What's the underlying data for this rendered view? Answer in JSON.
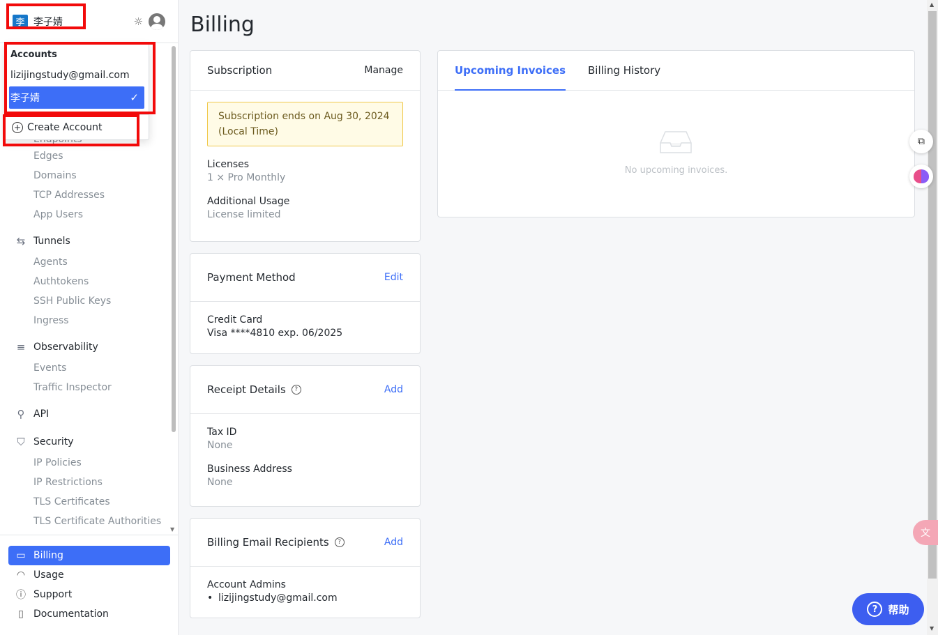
{
  "header": {
    "account_initial": "李",
    "account_name": "李子婧"
  },
  "dropdown": {
    "label": "Accounts",
    "items": [
      {
        "label": "lizijingstudy@gmail.com"
      },
      {
        "label": "李子婧"
      }
    ],
    "create_label": "Create Account"
  },
  "sidebar": {
    "partial_item": "Endpoints",
    "sub_items_1": [
      "Edges",
      "Domains",
      "TCP Addresses",
      "App Users"
    ],
    "tunnels": "Tunnels",
    "sub_items_tunnels": [
      "Agents",
      "Authtokens",
      "SSH Public Keys",
      "Ingress"
    ],
    "observability": "Observability",
    "sub_items_obs": [
      "Events",
      "Traffic Inspector"
    ],
    "api": "API",
    "security": "Security",
    "sub_items_security": [
      "IP Policies",
      "IP Restrictions",
      "TLS Certificates",
      "TLS Certificate Authorities"
    ],
    "bottom": [
      "Billing",
      "Usage",
      "Support",
      "Documentation"
    ]
  },
  "page": {
    "title": "Billing"
  },
  "subscription": {
    "title": "Subscription",
    "action": "Manage",
    "notice": "Subscription ends on Aug 30, 2024 (Local Time)",
    "licenses_label": "Licenses",
    "licenses_value": "1 × Pro Monthly",
    "usage_label": "Additional Usage",
    "usage_value": "License limited"
  },
  "payment": {
    "title": "Payment Method",
    "action": "Edit",
    "label": "Credit Card",
    "value": "Visa ****4810 exp. 06/2025"
  },
  "receipt": {
    "title": "Receipt Details",
    "action": "Add",
    "tax_label": "Tax ID",
    "tax_value": "None",
    "address_label": "Business Address",
    "address_value": "None"
  },
  "recipients": {
    "title": "Billing Email Recipients",
    "action": "Add",
    "label": "Account Admins",
    "value": "lizijingstudy@gmail.com"
  },
  "invoices": {
    "tabs": [
      "Upcoming Invoices",
      "Billing History"
    ],
    "empty_text": "No upcoming invoices."
  },
  "help_button": {
    "label": "帮助"
  },
  "colors": {
    "accent": "#3d6ef7",
    "highlight": "#f20a0a"
  }
}
